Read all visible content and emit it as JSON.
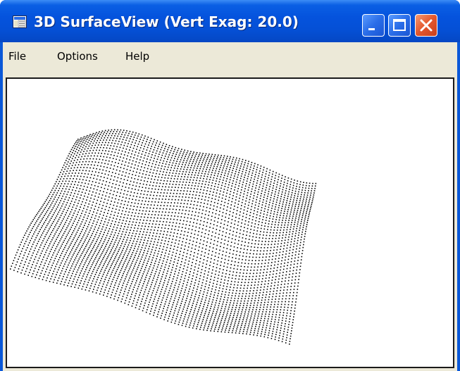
{
  "window": {
    "title": "3D SurfaceView (Vert Exag: 20.0)",
    "app_icon": "surface-app-icon",
    "buttons": {
      "minimize_icon": "minimize-icon",
      "maximize_icon": "maximize-icon",
      "close_icon": "close-icon"
    },
    "colors": {
      "titlebar": "#0553dd",
      "close_button": "#e4562c",
      "menubar": "#ece9d8",
      "canvas": "#ffffff",
      "points": "#000000"
    }
  },
  "menu": {
    "items": [
      {
        "label": "File"
      },
      {
        "label": "Options"
      },
      {
        "label": "Help"
      }
    ]
  },
  "view": {
    "vertical_exaggeration": 20.0,
    "render_mode": "point-cloud wireframe"
  }
}
